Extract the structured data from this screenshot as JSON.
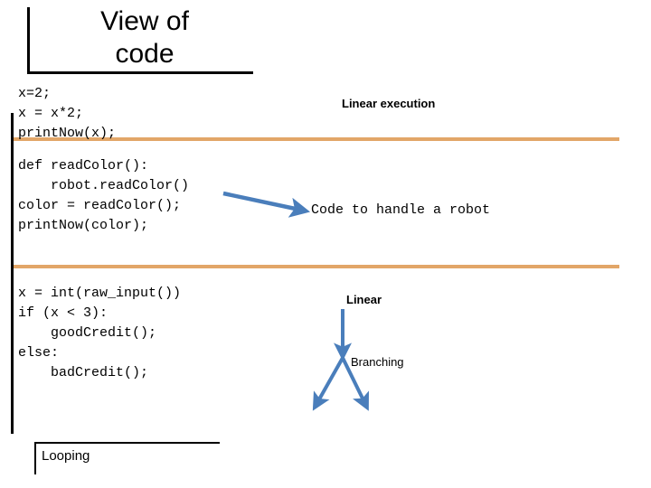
{
  "slide": {
    "title": "View of\ncode",
    "background_color": "#ffffff",
    "accent_color": "#e2a668",
    "arrow_color": "#4a7ebb",
    "rule_color": "#000000"
  },
  "code_blocks": [
    {
      "id": "linear",
      "text": "x=2;\nx = x*2;\nprintNow(x);"
    },
    {
      "id": "function",
      "text": "def readColor():\n    robot.readColor()\ncolor = readColor();\nprintNow(color);"
    },
    {
      "id": "branching",
      "text": "x = int(raw_input())\nif (x < 3):\n    goodCredit();\nelse:\n    badCredit();"
    }
  ],
  "annotations": {
    "linear_execution": "Linear execution",
    "code_to_handle_a_robot": "Code to handle a robot",
    "linear": "Linear",
    "branching": "Branching",
    "looping": "Looping"
  }
}
